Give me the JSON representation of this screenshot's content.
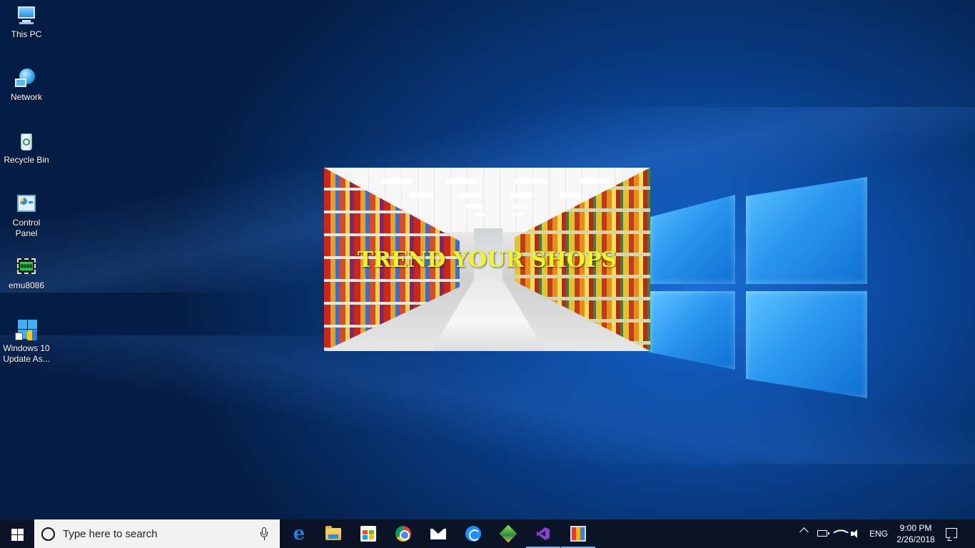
{
  "desktop": {
    "icons": [
      {
        "label": "This PC"
      },
      {
        "label": "Network"
      },
      {
        "label": "Recycle Bin"
      },
      {
        "label": "Control Panel"
      },
      {
        "label": "emu8086"
      },
      {
        "label": "Windows 10 Update As..."
      }
    ],
    "emu_chip_text": "8086"
  },
  "splash": {
    "title": "TREND YOUR SHOPS"
  },
  "taskbar": {
    "search_placeholder": "Type here to search",
    "apps": [
      {
        "icon": "edge-icon"
      },
      {
        "icon": "file-explorer-icon"
      },
      {
        "icon": "store-icon"
      },
      {
        "icon": "chrome-icon"
      },
      {
        "icon": "mail-icon"
      },
      {
        "icon": "sync-app-icon"
      },
      {
        "icon": "gem-app-icon"
      },
      {
        "icon": "visual-studio-icon",
        "active": true
      },
      {
        "icon": "media-app-icon",
        "active": true
      }
    ],
    "tray": {
      "language": "ENG",
      "time": "9:00 PM",
      "date": "2/26/2018"
    }
  },
  "colors": {
    "taskbar_bg": "#0b1426",
    "splash_title": "#f3f32a",
    "wallpaper_accent": "#1a6fd6"
  }
}
